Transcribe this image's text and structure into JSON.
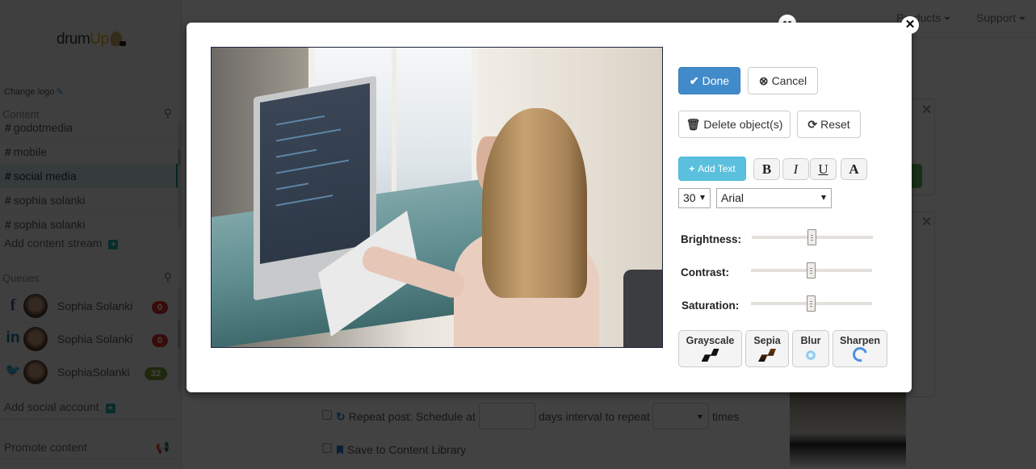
{
  "sidebar": {
    "logo_text_a": "drum",
    "logo_text_b": "Up",
    "change_logo": "Change logo",
    "content_heading": "Content",
    "streams": [
      {
        "label": "godotmedia",
        "active": false
      },
      {
        "label": "mobile",
        "active": false
      },
      {
        "label": "social media",
        "active": true
      },
      {
        "label": "sophia solanki",
        "active": false
      },
      {
        "label": "sophia solanki",
        "active": false
      }
    ],
    "add_content_stream": "Add content stream",
    "queues_heading": "Queues",
    "queues": [
      {
        "network": "facebook",
        "icon": "f",
        "name": "Sophia Solanki",
        "count": "0"
      },
      {
        "network": "linkedin",
        "icon": "in",
        "name": "Sophia Solanki",
        "count": "0"
      },
      {
        "network": "twitter",
        "icon": "🐦",
        "name": "SophiaSolanki",
        "count": "32"
      }
    ],
    "add_social_account": "Add social account",
    "promote_content": "Promote content"
  },
  "topnav": {
    "products": "Products",
    "support": "Support"
  },
  "post_form": {
    "repeat_label": "Repeat post: Schedule at",
    "days_value": "",
    "days_interval_label": "days interval to repeat",
    "times_value": "",
    "times_label": "times",
    "save_library_label": "Save to Content Library"
  },
  "editor": {
    "close_symbol": "✕",
    "done_label": "Done",
    "cancel_label": "Cancel",
    "delete_label": "Delete object(s)",
    "reset_label": "Reset",
    "add_text_label": "Add Text",
    "bold_label": "B",
    "italic_label": "I",
    "underline_label": "U",
    "color_label": "A",
    "font_size": "30",
    "font_family": "Arial",
    "sliders": [
      {
        "label": "Brightness:",
        "value_pct": 50
      },
      {
        "label": "Contrast:",
        "value_pct": 50
      },
      {
        "label": "Saturation:",
        "value_pct": 50
      }
    ],
    "filters": [
      {
        "label": "Grayscale",
        "icon": "film-gray-icon"
      },
      {
        "label": "Sepia",
        "icon": "film-sepia-icon"
      },
      {
        "label": "Blur",
        "icon": "blur-icon"
      },
      {
        "label": "Sharpen",
        "icon": "sharpen-icon"
      }
    ],
    "image_alt": "Woman typing code on a desktop computer"
  },
  "colors": {
    "primary": "#428bca",
    "info": "#5bc0de",
    "badge_red": "#d9302f",
    "badge_green": "#7a9b2e",
    "accent_teal": "#1a8a8a"
  }
}
